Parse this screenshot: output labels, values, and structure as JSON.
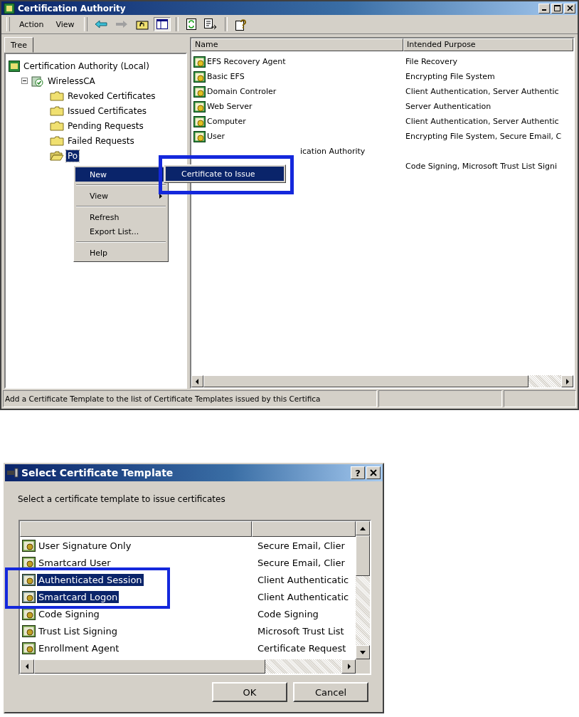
{
  "main_window": {
    "title": "Certification Authority",
    "menus": [
      {
        "label": "Action"
      },
      {
        "label": "View"
      }
    ],
    "tree_tab": "Tree",
    "tree": [
      {
        "label": "Certification Authority (Local)",
        "kind": "root",
        "selected": false,
        "children": [
          {
            "label": "WirelessCA",
            "kind": "ca",
            "selected": false,
            "expanded": true,
            "children": [
              {
                "label": "Revoked Certificates",
                "kind": "folder",
                "selected": false
              },
              {
                "label": "Issued Certificates",
                "kind": "folder",
                "selected": false
              },
              {
                "label": "Pending Requests",
                "kind": "folder",
                "selected": false
              },
              {
                "label": "Failed Requests",
                "kind": "folder",
                "selected": false
              },
              {
                "label": "Po",
                "kind": "open-folder",
                "selected": true
              }
            ]
          }
        ]
      }
    ],
    "columns": [
      "Name",
      "Intended Purpose"
    ],
    "rows": [
      {
        "name": "EFS Recovery Agent",
        "purpose": "File Recovery",
        "icon": true
      },
      {
        "name": "Basic EFS",
        "purpose": "Encrypting File System",
        "icon": true
      },
      {
        "name": "Domain Controler",
        "purpose": "Client Authentication, Server Authentic",
        "icon": true
      },
      {
        "name": "Web Server",
        "purpose": "Server Authentication",
        "icon": true
      },
      {
        "name": "Computer",
        "purpose": "Client Authentication, Server Authentic",
        "icon": true
      },
      {
        "name": "User",
        "purpose": "Encrypting File System, Secure Email, C",
        "icon": true
      },
      {
        "name": "ication Authority",
        "icon": false
      },
      {
        "purpose": "Code Signing, Microsoft Trust List Signi",
        "icon": false
      }
    ],
    "context_menu": [
      {
        "kind": "item",
        "label": "New",
        "submenu": true,
        "selected": true
      },
      {
        "kind": "separator"
      },
      {
        "kind": "item",
        "label": "View",
        "submenu": true,
        "selected": false
      },
      {
        "kind": "separator"
      },
      {
        "kind": "item",
        "label": "Refresh",
        "submenu": false,
        "selected": false
      },
      {
        "kind": "item",
        "label": "Export List...",
        "submenu": false,
        "selected": false
      },
      {
        "kind": "separator"
      },
      {
        "kind": "item",
        "label": "Help",
        "submenu": false,
        "selected": false
      }
    ],
    "submenu": [
      {
        "label": "Certificate to Issue",
        "selected": true
      }
    ],
    "status_bar": "Add a Certificate Template to the list of Certificate Templates issued by this Certifica"
  },
  "dialog": {
    "title": "Select Certificate Template",
    "help_button": "?",
    "prompt": "Select a certificate template to issue certificates",
    "rows": [
      {
        "name": "User Signature Only",
        "purpose": "Secure Email, Clier",
        "selected": false
      },
      {
        "name": "Smartcard User",
        "purpose": "Secure Email, Clier",
        "selected": false
      },
      {
        "name": "Authenticated Session",
        "purpose": "Client Authenticatic",
        "selected": true
      },
      {
        "name": "Smartcard Logon",
        "purpose": "Client Authenticatic",
        "selected": true
      },
      {
        "name": "Code Signing",
        "purpose": "Code Signing",
        "selected": false
      },
      {
        "name": "Trust List Signing",
        "purpose": "Microsoft Trust List",
        "selected": false
      },
      {
        "name": "Enrollment Agent",
        "purpose": "Certificate Request",
        "selected": false
      }
    ],
    "buttons": [
      "OK",
      "Cancel"
    ]
  }
}
